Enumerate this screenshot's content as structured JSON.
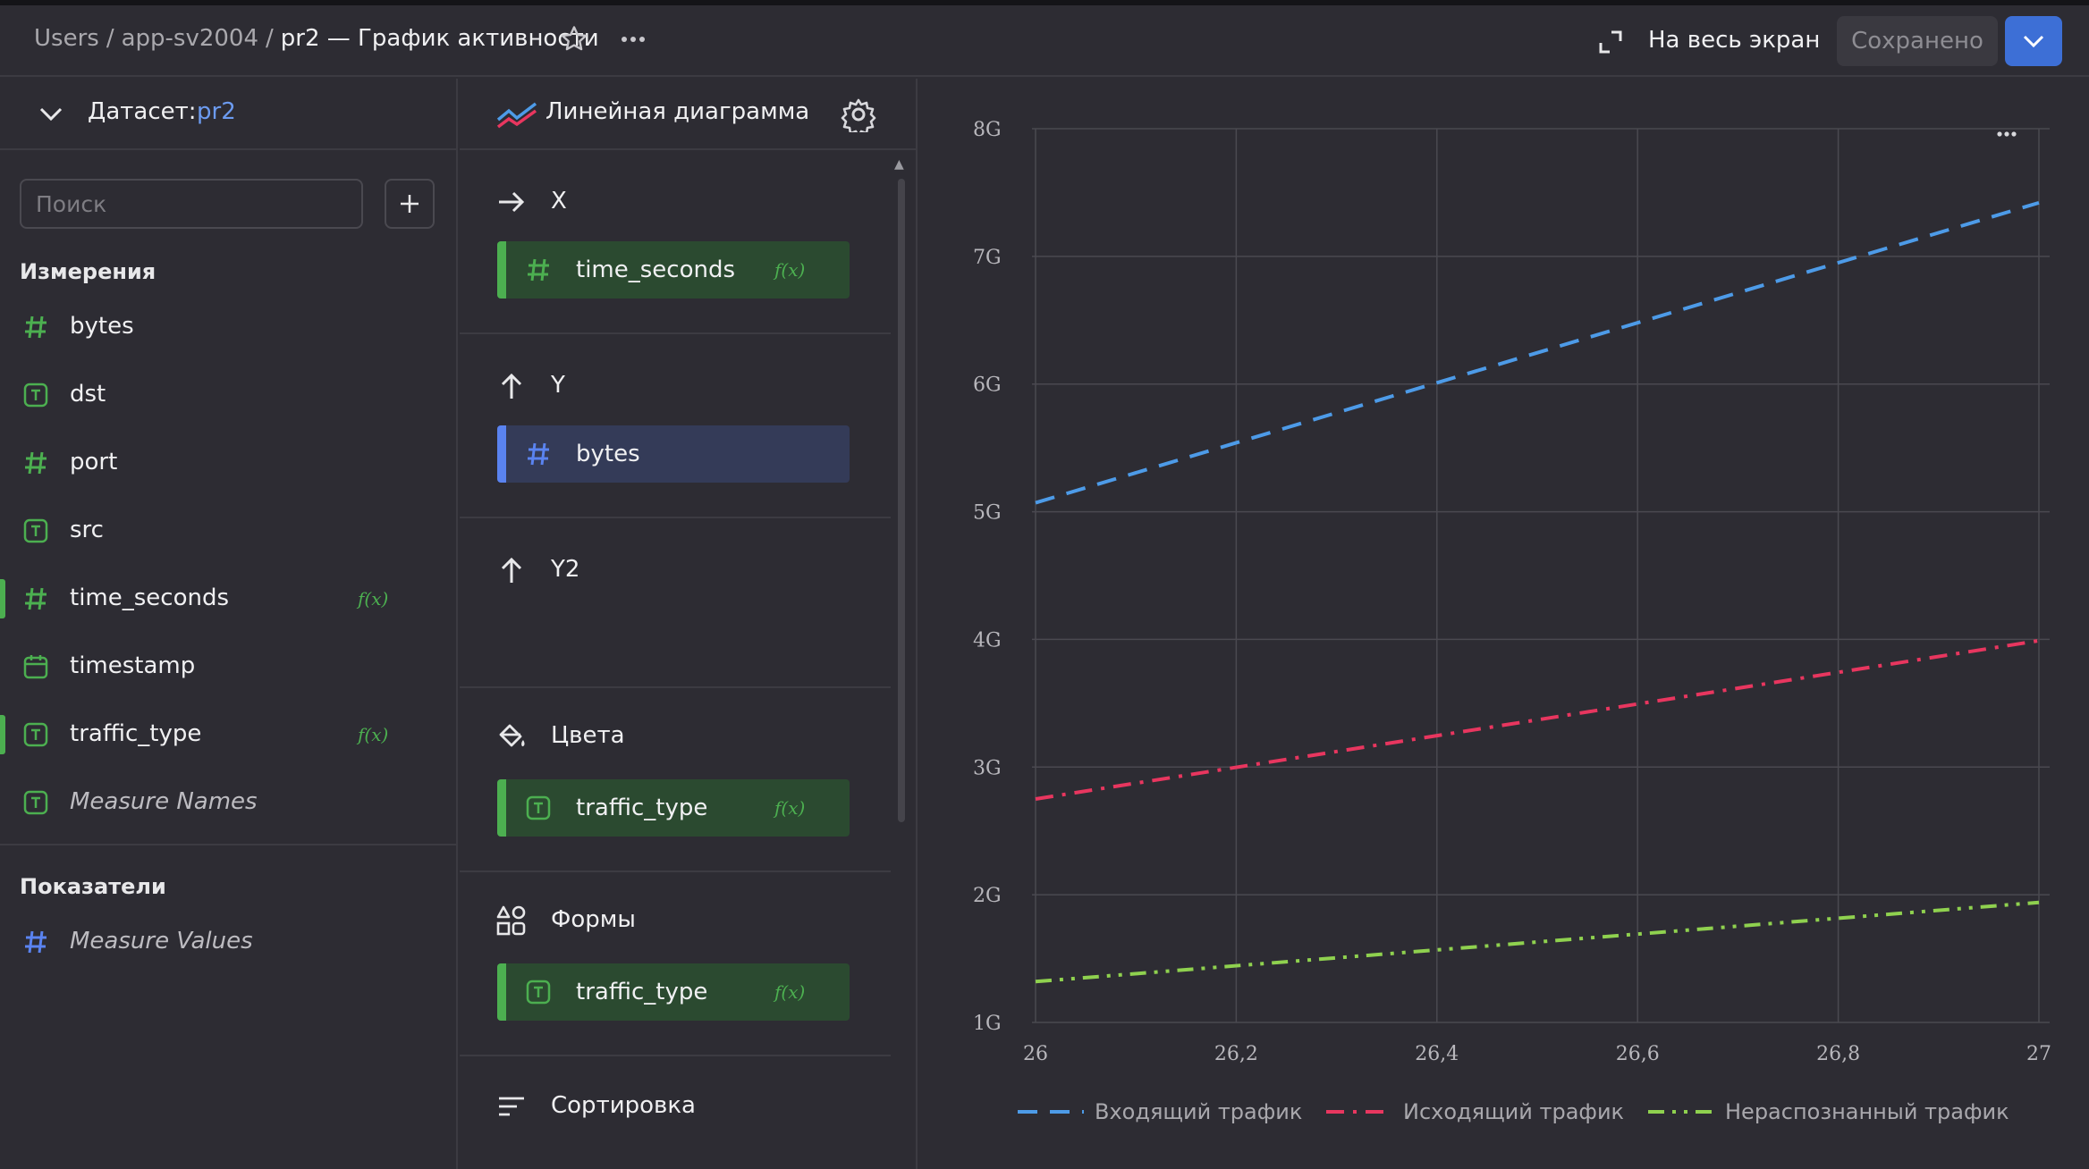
{
  "header": {
    "breadcrumb": [
      "Users",
      "app-sv2004"
    ],
    "separator": "/",
    "current": "pr2 — График активности",
    "fullscreen_label": "На весь экран",
    "saved_label": "Сохранено"
  },
  "dataset": {
    "label": "Датасет:",
    "name": "pr2",
    "search_placeholder": "Поиск",
    "dimensions_title": "Измерения",
    "dimensions": [
      {
        "label": "bytes",
        "type": "number",
        "fx": ""
      },
      {
        "label": "dst",
        "type": "text",
        "fx": ""
      },
      {
        "label": "port",
        "type": "number",
        "fx": ""
      },
      {
        "label": "src",
        "type": "text",
        "fx": ""
      },
      {
        "label": "time_seconds",
        "type": "number",
        "fx": "f(x)"
      },
      {
        "label": "timestamp",
        "type": "date",
        "fx": ""
      },
      {
        "label": "traffic_type",
        "type": "text",
        "fx": "f(x)"
      },
      {
        "label": "Measure Names",
        "type": "text",
        "fx": ""
      }
    ],
    "measures_title": "Показатели",
    "measures": [
      {
        "label": "Measure Values",
        "type": "number"
      }
    ]
  },
  "wizard": {
    "chart_type_label": "Линейная диаграмма",
    "x_label": "X",
    "x_field": "time_seconds",
    "x_fx": "f(x)",
    "y_label": "Y",
    "y_field": "bytes",
    "y2_label": "Y2",
    "colors_label": "Цвета",
    "colors_field": "traffic_type",
    "colors_fx": "f(x)",
    "shapes_label": "Формы",
    "shapes_field": "traffic_type",
    "shapes_fx": "f(x)",
    "sort_label": "Сортировка"
  },
  "colors": {
    "incoming": "#4d9be8",
    "outgoing": "#e8365f",
    "unknown": "#8fd14f",
    "accent": "#3d6fd6",
    "dimension_green": "#4caf50",
    "measure_blue": "#5a83f0"
  },
  "chart_data": {
    "type": "line",
    "title": "",
    "xlabel": "",
    "ylabel": "",
    "xlim": [
      26,
      27
    ],
    "ylim": [
      1,
      8
    ],
    "x_ticks": [
      "26",
      "26,2",
      "26,4",
      "26,6",
      "26,8",
      "27"
    ],
    "y_ticks": [
      "1G",
      "2G",
      "3G",
      "4G",
      "5G",
      "6G",
      "7G",
      "8G"
    ],
    "grid": true,
    "legend_position": "bottom",
    "series": [
      {
        "name": "Входящий трафик",
        "style": "dash",
        "x": [
          26,
          27
        ],
        "values": [
          5.07,
          7.42
        ]
      },
      {
        "name": "Исходящий трафик",
        "style": "dash-dot",
        "x": [
          26,
          27
        ],
        "values": [
          2.75,
          3.99
        ]
      },
      {
        "name": "Нераспознанный трафик",
        "style": "dash-dot-dot",
        "x": [
          26,
          27
        ],
        "values": [
          1.32,
          1.94
        ]
      }
    ]
  }
}
